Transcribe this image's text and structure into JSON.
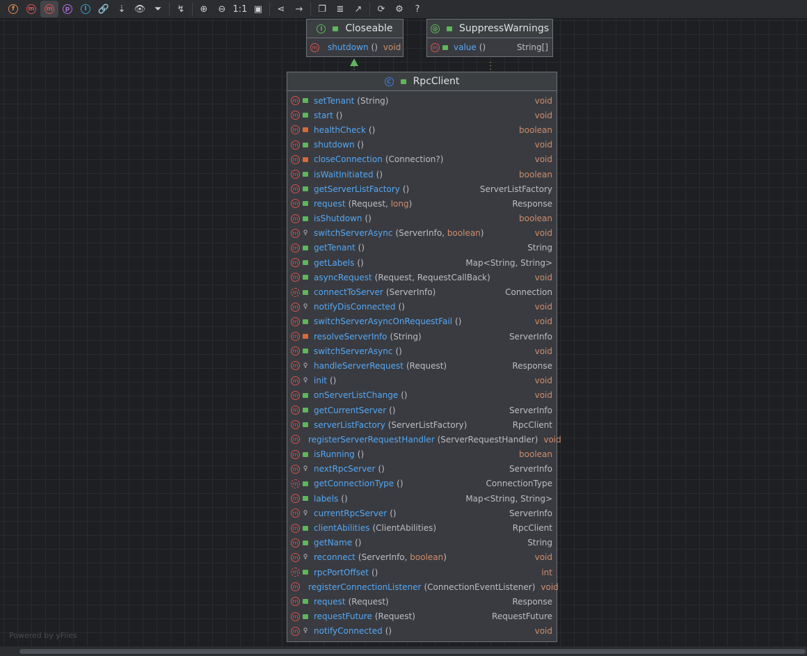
{
  "toolbar": {
    "items": [
      {
        "icon": "field-icon",
        "label": "f",
        "color": "#e08b4d"
      },
      {
        "icon": "constructor-icon",
        "label": "m",
        "color": "#d9534f"
      },
      {
        "icon": "method-icon",
        "label": "m",
        "color": "#d9534f",
        "active": true
      },
      {
        "icon": "property-icon",
        "label": "p",
        "color": "#b070e0"
      },
      {
        "icon": "inner-class-icon",
        "label": "I",
        "color": "#3a9fc8"
      },
      {
        "icon": "link-icon",
        "label": "🔗"
      },
      {
        "icon": "sort-icon",
        "label": "⇣"
      },
      {
        "icon": "visibility-icon",
        "label": "👁"
      },
      {
        "icon": "filter-icon",
        "label": "⏷"
      },
      {
        "sep": true
      },
      {
        "icon": "route-edges-icon",
        "label": "↯"
      },
      {
        "sep": true
      },
      {
        "icon": "zoom-in-icon",
        "label": "⊕"
      },
      {
        "icon": "zoom-out-icon",
        "label": "⊖"
      },
      {
        "icon": "actual-size-icon",
        "label": "1:1"
      },
      {
        "icon": "fit-content-icon",
        "label": "▣"
      },
      {
        "sep": true
      },
      {
        "icon": "layout-icon",
        "label": "⋖"
      },
      {
        "icon": "apply-layout-icon",
        "label": "→"
      },
      {
        "sep": true
      },
      {
        "icon": "copy-icon",
        "label": "❐"
      },
      {
        "icon": "edit-description-icon",
        "label": "≣"
      },
      {
        "icon": "export-icon",
        "label": "↗"
      },
      {
        "sep": true
      },
      {
        "icon": "refresh-icon",
        "label": "⟳"
      },
      {
        "icon": "settings-icon",
        "label": "⚙"
      },
      {
        "icon": "help-icon",
        "label": "?"
      }
    ]
  },
  "colors": {
    "public": "#5fb65b",
    "private": "#d66a3a",
    "method": "#d9534f",
    "name": "#56a8f5",
    "primitive": "#cf8e6d"
  },
  "closeable": {
    "title": "Closeable",
    "kind": "I",
    "kind_color": "#5fb65b",
    "methods": [
      {
        "name": "shutdown",
        "params": "()",
        "ret": "void",
        "retPrim": true,
        "vis": "pub"
      }
    ]
  },
  "suppress": {
    "title": "SuppressWarnings",
    "kind": "@",
    "kind_color": "#5fb65b",
    "methods": [
      {
        "name": "value",
        "params": "()",
        "ret": "String[]",
        "retPrim": false,
        "vis": "pub"
      }
    ]
  },
  "rpcclient": {
    "title": "RpcClient",
    "kind": "C",
    "kind_color": "#3d7fe0",
    "methods": [
      {
        "name": "setTenant",
        "p": [
          [
            "(String)",
            0
          ]
        ],
        "ret": "void",
        "rp": 1,
        "vis": "pub"
      },
      {
        "name": "start",
        "p": [
          [
            "()",
            0
          ]
        ],
        "ret": "void",
        "rp": 1,
        "vis": "pub"
      },
      {
        "name": "healthCheck",
        "p": [
          [
            "()",
            0
          ]
        ],
        "ret": "boolean",
        "rp": 1,
        "vis": "priv"
      },
      {
        "name": "shutdown",
        "p": [
          [
            "()",
            0
          ]
        ],
        "ret": "void",
        "rp": 1,
        "vis": "pub"
      },
      {
        "name": "closeConnection",
        "p": [
          [
            "(Connection?)",
            0
          ]
        ],
        "ret": "void",
        "rp": 1,
        "vis": "priv"
      },
      {
        "name": "isWaitInitiated",
        "p": [
          [
            "()",
            0
          ]
        ],
        "ret": "boolean",
        "rp": 1,
        "vis": "pub"
      },
      {
        "name": "getServerListFactory",
        "p": [
          [
            "()",
            0
          ]
        ],
        "ret": "ServerListFactory",
        "rp": 0,
        "vis": "pub"
      },
      {
        "name": "request",
        "p": [
          [
            "(Request, ",
            0
          ],
          [
            "long",
            1
          ],
          [
            ")",
            0
          ]
        ],
        "ret": "Response",
        "rp": 0,
        "vis": "pub"
      },
      {
        "name": "isShutdown",
        "p": [
          [
            "()",
            0
          ]
        ],
        "ret": "boolean",
        "rp": 1,
        "vis": "pub"
      },
      {
        "name": "switchServerAsync",
        "p": [
          [
            "(ServerInfo, ",
            0
          ],
          [
            "boolean",
            1
          ],
          [
            ")",
            0
          ]
        ],
        "ret": "void",
        "rp": 1,
        "vis": "pkg"
      },
      {
        "name": "getTenant",
        "p": [
          [
            "()",
            0
          ]
        ],
        "ret": "String",
        "rp": 0,
        "vis": "pub"
      },
      {
        "name": "getLabels",
        "p": [
          [
            "()",
            0
          ]
        ],
        "ret": "Map<String, String>",
        "rp": 0,
        "vis": "pub"
      },
      {
        "name": "asyncRequest",
        "p": [
          [
            "(Request, RequestCallBack)",
            0
          ]
        ],
        "ret": "void",
        "rp": 1,
        "vis": "pub"
      },
      {
        "name": "connectToServer",
        "p": [
          [
            "(ServerInfo)",
            0
          ]
        ],
        "ret": "Connection",
        "rp": 0,
        "vis": "pub",
        "abs": 1
      },
      {
        "name": "notifyDisConnected",
        "p": [
          [
            "()",
            0
          ]
        ],
        "ret": "void",
        "rp": 1,
        "vis": "pkg"
      },
      {
        "name": "switchServerAsyncOnRequestFail",
        "p": [
          [
            "()",
            0
          ]
        ],
        "ret": "void",
        "rp": 1,
        "vis": "pub"
      },
      {
        "name": "resolveServerInfo",
        "p": [
          [
            "(String)",
            0
          ]
        ],
        "ret": "ServerInfo",
        "rp": 0,
        "vis": "priv"
      },
      {
        "name": "switchServerAsync",
        "p": [
          [
            "()",
            0
          ]
        ],
        "ret": "void",
        "rp": 1,
        "vis": "pub"
      },
      {
        "name": "handleServerRequest",
        "p": [
          [
            "(Request)",
            0
          ]
        ],
        "ret": "Response",
        "rp": 0,
        "vis": "pkg"
      },
      {
        "name": "init",
        "p": [
          [
            "()",
            0
          ]
        ],
        "ret": "void",
        "rp": 1,
        "vis": "pkg"
      },
      {
        "name": "onServerListChange",
        "p": [
          [
            "()",
            0
          ]
        ],
        "ret": "void",
        "rp": 1,
        "vis": "pub"
      },
      {
        "name": "getCurrentServer",
        "p": [
          [
            "()",
            0
          ]
        ],
        "ret": "ServerInfo",
        "rp": 0,
        "vis": "pub"
      },
      {
        "name": "serverListFactory",
        "p": [
          [
            "(ServerListFactory)",
            0
          ]
        ],
        "ret": "RpcClient",
        "rp": 0,
        "vis": "pub"
      },
      {
        "name": "registerServerRequestHandler",
        "p": [
          [
            "(ServerRequestHandler)",
            0
          ]
        ],
        "ret": "void",
        "rp": 1,
        "vis": "pub"
      },
      {
        "name": "isRunning",
        "p": [
          [
            "()",
            0
          ]
        ],
        "ret": "boolean",
        "rp": 1,
        "vis": "pub"
      },
      {
        "name": "nextRpcServer",
        "p": [
          [
            "()",
            0
          ]
        ],
        "ret": "ServerInfo",
        "rp": 0,
        "vis": "pkg"
      },
      {
        "name": "getConnectionType",
        "p": [
          [
            "()",
            0
          ]
        ],
        "ret": "ConnectionType",
        "rp": 0,
        "vis": "pub",
        "abs": 1
      },
      {
        "name": "labels",
        "p": [
          [
            "()",
            0
          ]
        ],
        "ret": "Map<String, String>",
        "rp": 0,
        "vis": "pub"
      },
      {
        "name": "currentRpcServer",
        "p": [
          [
            "()",
            0
          ]
        ],
        "ret": "ServerInfo",
        "rp": 0,
        "vis": "pkg"
      },
      {
        "name": "clientAbilities",
        "p": [
          [
            "(ClientAbilities)",
            0
          ]
        ],
        "ret": "RpcClient",
        "rp": 0,
        "vis": "pub"
      },
      {
        "name": "getName",
        "p": [
          [
            "()",
            0
          ]
        ],
        "ret": "String",
        "rp": 0,
        "vis": "pub"
      },
      {
        "name": "reconnect",
        "p": [
          [
            "(ServerInfo, ",
            0
          ],
          [
            "boolean",
            1
          ],
          [
            ")",
            0
          ]
        ],
        "ret": "void",
        "rp": 1,
        "vis": "pkg"
      },
      {
        "name": "rpcPortOffset",
        "p": [
          [
            "()",
            0
          ]
        ],
        "ret": "int",
        "rp": 1,
        "vis": "pub",
        "abs": 1
      },
      {
        "name": "registerConnectionListener",
        "p": [
          [
            "(ConnectionEventListener)",
            0
          ]
        ],
        "ret": "void",
        "rp": 1,
        "vis": "pub"
      },
      {
        "name": "request",
        "p": [
          [
            "(Request)",
            0
          ]
        ],
        "ret": "Response",
        "rp": 0,
        "vis": "pub"
      },
      {
        "name": "requestFuture",
        "p": [
          [
            "(Request)",
            0
          ]
        ],
        "ret": "RequestFuture",
        "rp": 0,
        "vis": "pub"
      },
      {
        "name": "notifyConnected",
        "p": [
          [
            "()",
            0
          ]
        ],
        "ret": "void",
        "rp": 1,
        "vis": "pkg"
      }
    ]
  },
  "footer": "Powered by yFiles"
}
